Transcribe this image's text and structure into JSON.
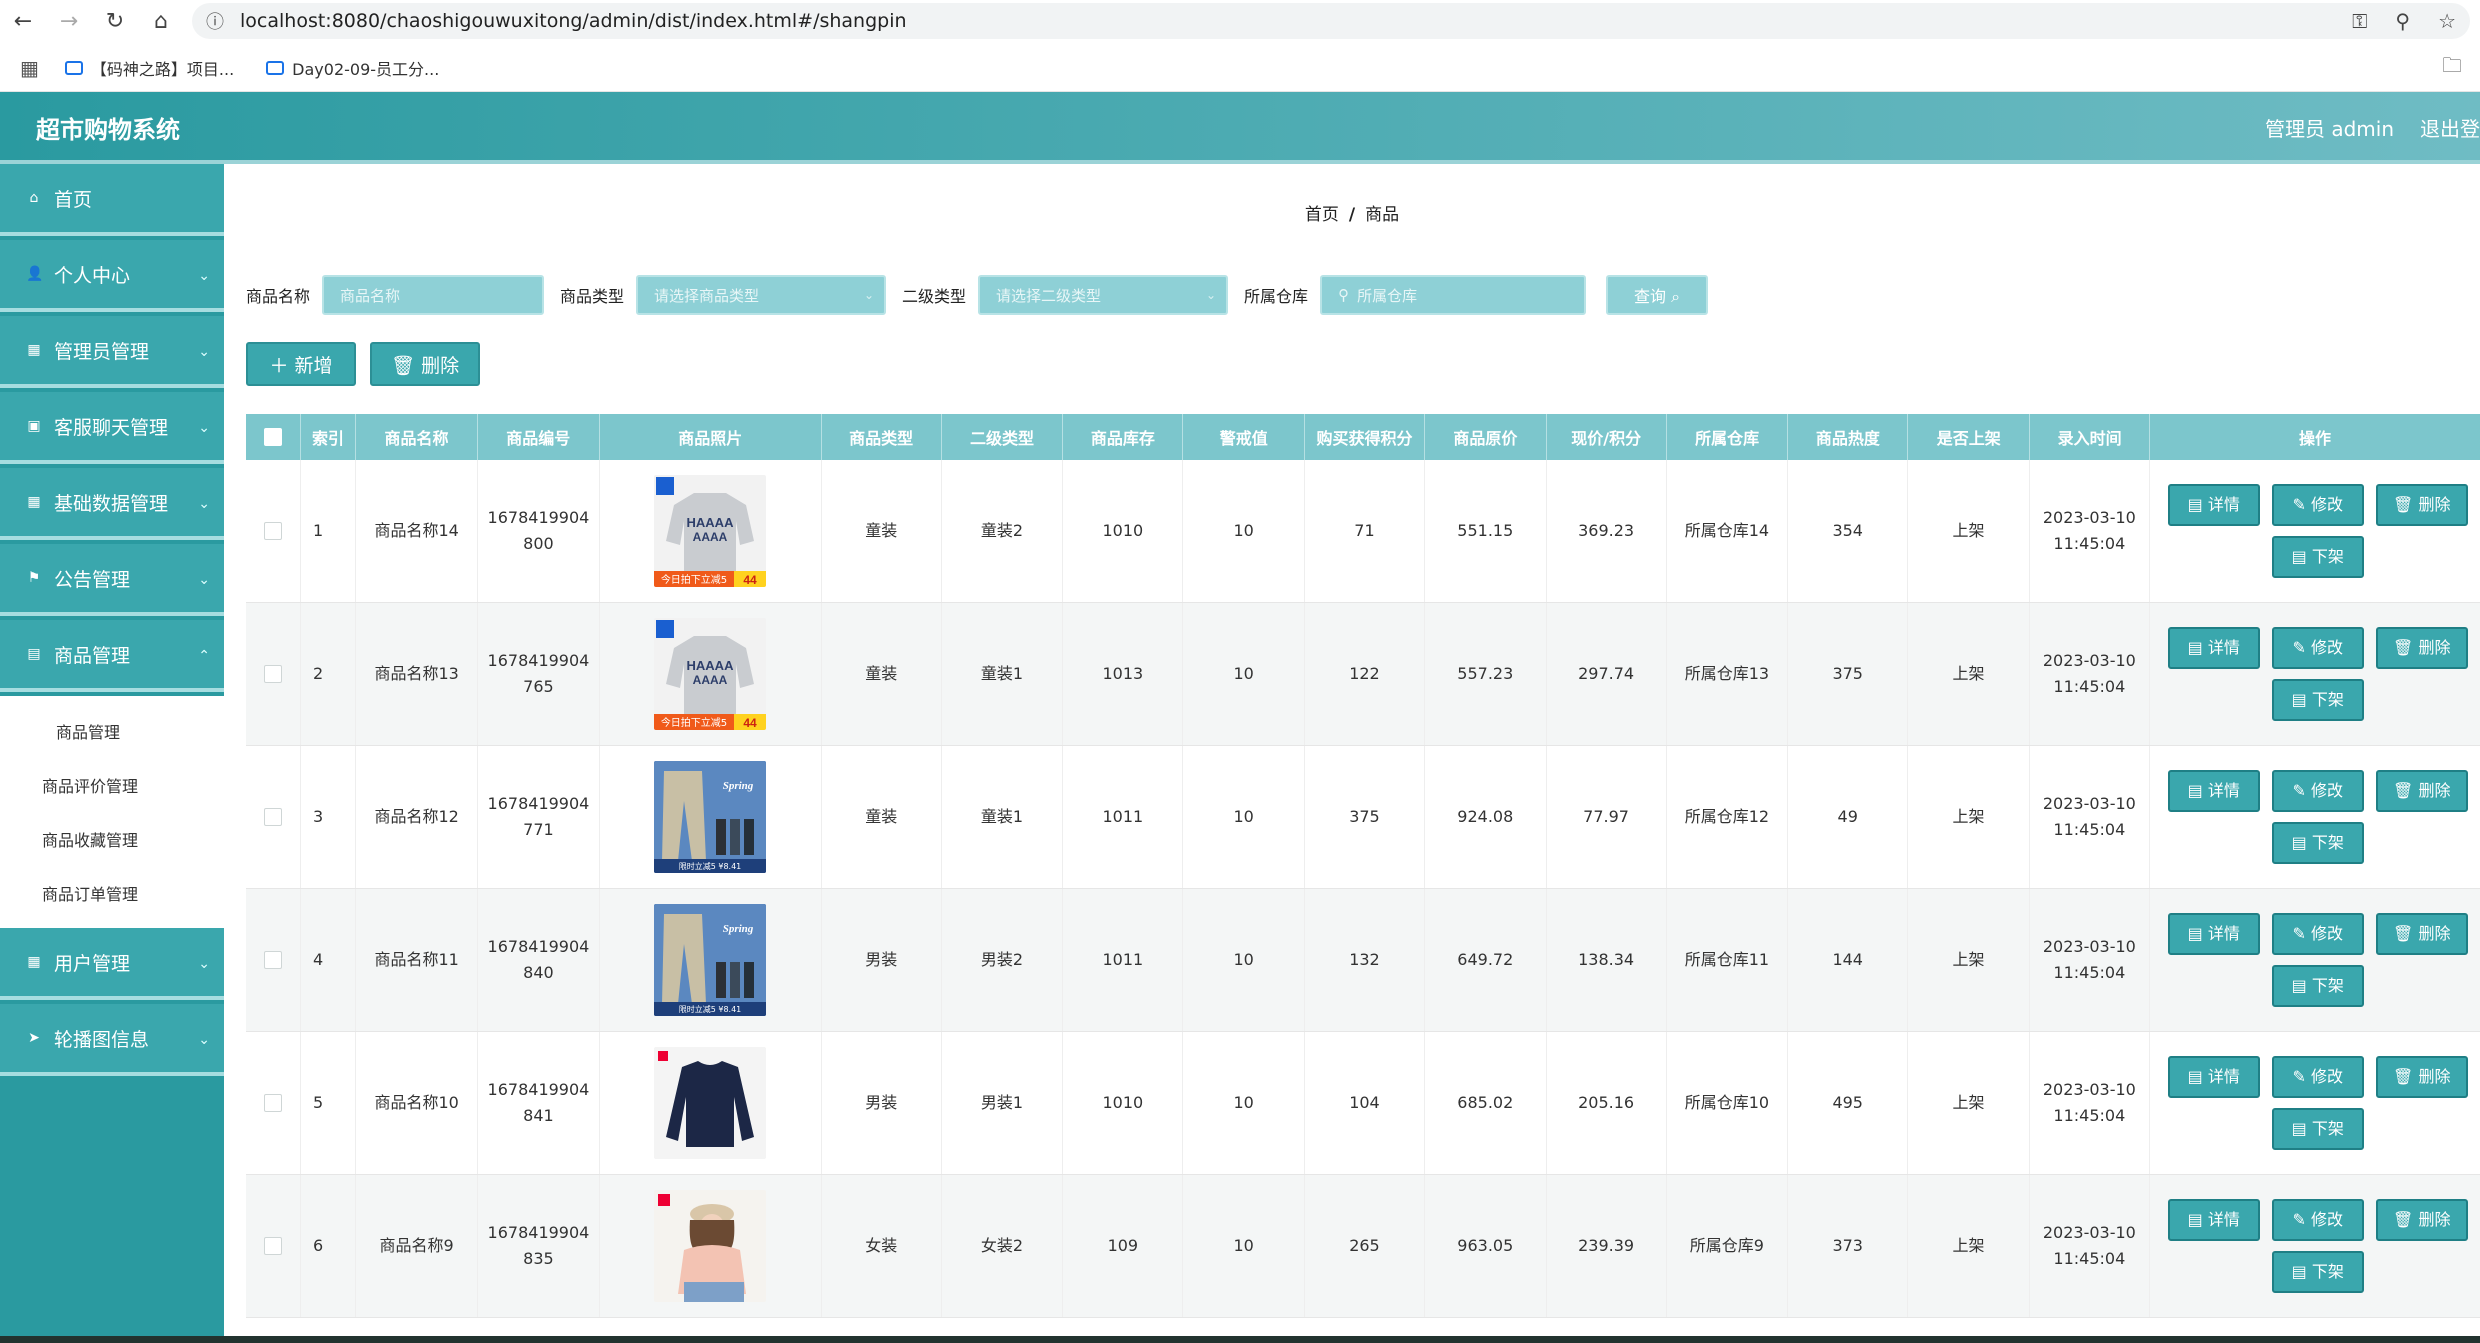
{
  "browser": {
    "url": "localhost:8080/chaoshigouwuxitong/admin/dist/index.html#/shangpin",
    "bookmarks": [
      "【码神之路】项目...",
      "Day02-09-员工分..."
    ]
  },
  "header": {
    "title": "超市购物系统",
    "user": "管理员 admin",
    "logout": "退出登"
  },
  "sidebar": {
    "items": [
      {
        "label": "首页",
        "icon": "home-icon"
      },
      {
        "label": "个人中心",
        "icon": "user-icon"
      },
      {
        "label": "管理员管理",
        "icon": "grid-icon"
      },
      {
        "label": "客服聊天管理",
        "icon": "calendar-icon"
      },
      {
        "label": "基础数据管理",
        "icon": "grid-icon"
      },
      {
        "label": "公告管理",
        "icon": "flag-icon"
      },
      {
        "label": "商品管理",
        "icon": "store-icon"
      },
      {
        "label": "用户管理",
        "icon": "grid-icon"
      },
      {
        "label": "轮播图信息",
        "icon": "send-icon"
      }
    ],
    "submenu": [
      "商品管理",
      "商品评价管理",
      "商品收藏管理",
      "商品订单管理"
    ]
  },
  "breadcrumb": {
    "home": "首页",
    "sep": "/",
    "current": "商品"
  },
  "filters": {
    "name_label": "商品名称",
    "name_placeholder": "商品名称",
    "type_label": "商品类型",
    "type_placeholder": "请选择商品类型",
    "subtype_label": "二级类型",
    "subtype_placeholder": "请选择二级类型",
    "warehouse_label": "所属仓库",
    "warehouse_placeholder": "所属仓库",
    "query": "查询 ⌕"
  },
  "actions": {
    "add": "＋ 新增",
    "delete": "🗑 删除"
  },
  "table": {
    "headers": [
      "",
      "索引",
      "商品名称",
      "商品编号",
      "商品照片",
      "商品类型",
      "二级类型",
      "商品库存",
      "警戒值",
      "购买获得积分",
      "商品原价",
      "现价/积分",
      "所属仓库",
      "商品热度",
      "是否上架",
      "录入时间",
      "操作"
    ],
    "ops": {
      "detail": "▤ 详情",
      "edit": "✎ 修改",
      "del": "🗑 删除",
      "down": "▤ 下架"
    },
    "rows": [
      {
        "idx": "1",
        "name": "商品名称14",
        "code1": "1678419904",
        "code2": "800",
        "photo": "sweater",
        "type": "童装",
        "sub": "童装2",
        "stock": "1010",
        "warn": "10",
        "points": "71",
        "orig": "551.15",
        "now": "369.23",
        "wh": "所属仓库14",
        "hot": "354",
        "up": "上架",
        "date": "2023-03-10",
        "time": "11:45:04"
      },
      {
        "idx": "2",
        "name": "商品名称13",
        "code1": "1678419904",
        "code2": "765",
        "photo": "sweater",
        "type": "童装",
        "sub": "童装1",
        "stock": "1013",
        "warn": "10",
        "points": "122",
        "orig": "557.23",
        "now": "297.74",
        "wh": "所属仓库13",
        "hot": "375",
        "up": "上架",
        "date": "2023-03-10",
        "time": "11:45:04"
      },
      {
        "idx": "3",
        "name": "商品名称12",
        "code1": "1678419904",
        "code2": "771",
        "photo": "pants",
        "type": "童装",
        "sub": "童装1",
        "stock": "1011",
        "warn": "10",
        "points": "375",
        "orig": "924.08",
        "now": "77.97",
        "wh": "所属仓库12",
        "hot": "49",
        "up": "上架",
        "date": "2023-03-10",
        "time": "11:45:04"
      },
      {
        "idx": "4",
        "name": "商品名称11",
        "code1": "1678419904",
        "code2": "840",
        "photo": "pants",
        "type": "男装",
        "sub": "男装2",
        "stock": "1011",
        "warn": "10",
        "points": "132",
        "orig": "649.72",
        "now": "138.34",
        "wh": "所属仓库11",
        "hot": "144",
        "up": "上架",
        "date": "2023-03-10",
        "time": "11:45:04"
      },
      {
        "idx": "5",
        "name": "商品名称10",
        "code1": "1678419904",
        "code2": "841",
        "photo": "navy",
        "type": "男装",
        "sub": "男装1",
        "stock": "1010",
        "warn": "10",
        "points": "104",
        "orig": "685.02",
        "now": "205.16",
        "wh": "所属仓库10",
        "hot": "495",
        "up": "上架",
        "date": "2023-03-10",
        "time": "11:45:04"
      },
      {
        "idx": "6",
        "name": "商品名称9",
        "code1": "1678419904",
        "code2": "835",
        "photo": "woman",
        "type": "女装",
        "sub": "女装2",
        "stock": "109",
        "warn": "10",
        "points": "265",
        "orig": "963.05",
        "now": "239.39",
        "wh": "所属仓库9",
        "hot": "373",
        "up": "上架",
        "date": "2023-03-10",
        "time": "11:45:04"
      }
    ]
  },
  "photo_text": {
    "promo": "今日拍下立减5",
    "price": "44",
    "spring": "Spring",
    "pants_promo": "限时立减5  ¥8.41"
  },
  "colors": {
    "primary": "#3aa7ad",
    "header_start": "#2a9aa0",
    "header_end": "#6fbcc4",
    "table_head": "#7cc6cc"
  }
}
